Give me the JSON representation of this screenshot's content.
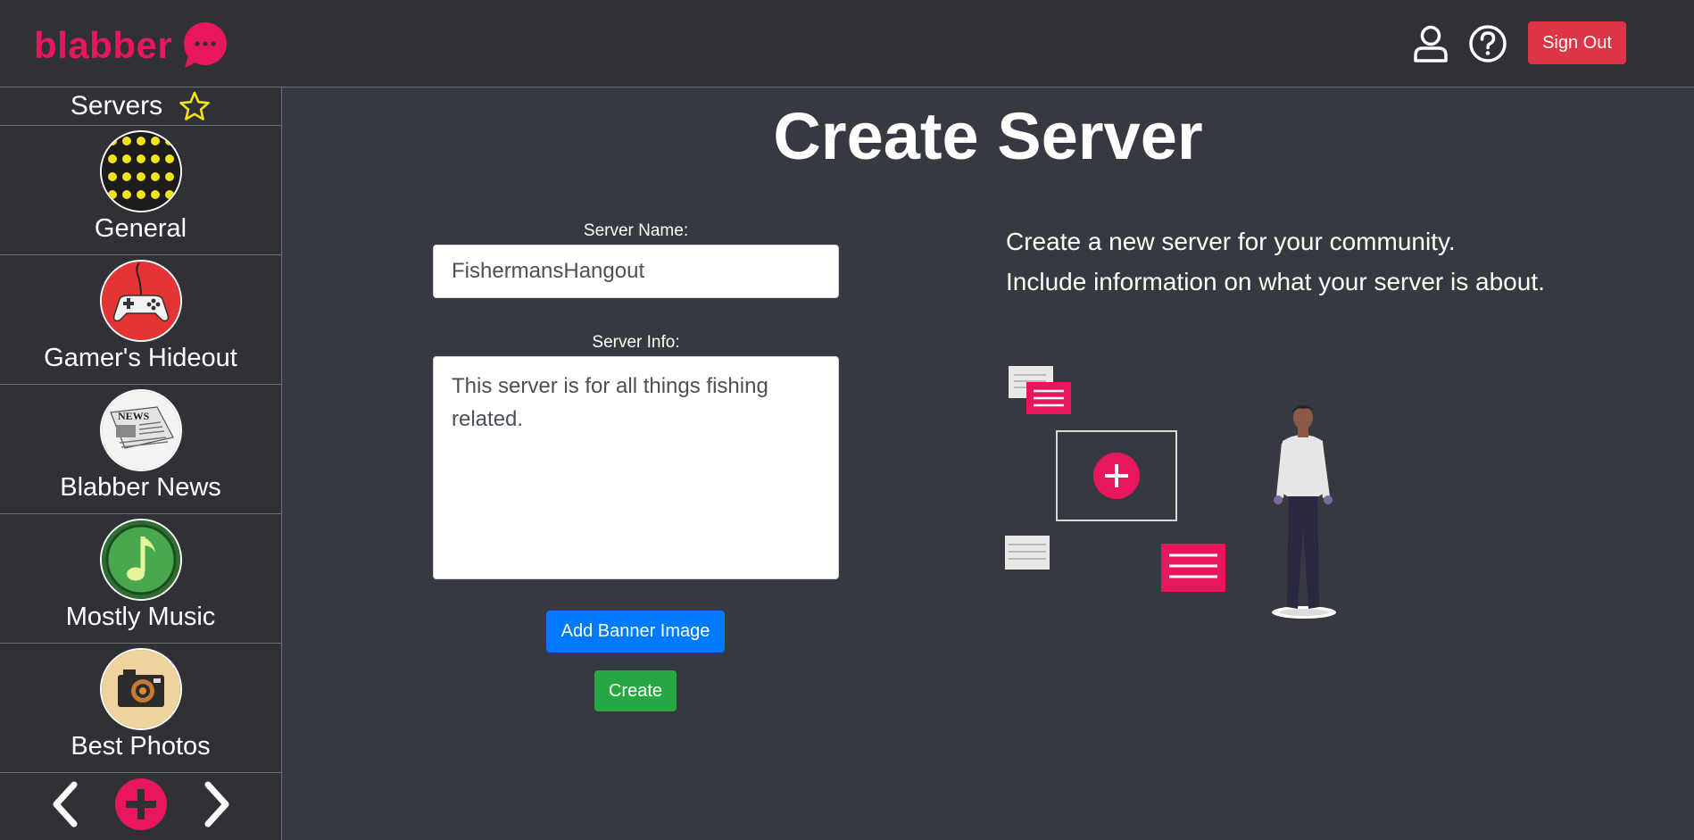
{
  "header": {
    "brand": "blabber",
    "signout_label": "Sign Out"
  },
  "sidebar": {
    "title": "Servers",
    "items": [
      {
        "label": "General"
      },
      {
        "label": "Gamer's Hideout"
      },
      {
        "label": "Blabber News"
      },
      {
        "label": "Mostly Music"
      },
      {
        "label": "Best Photos"
      }
    ],
    "news_text": "NEWS"
  },
  "main": {
    "title": "Create Server",
    "name_label": "Server Name:",
    "name_value": "FishermansHangout",
    "info_label": "Server Info:",
    "info_value": "This server is for all things fishing related.",
    "banner_button": "Add Banner Image",
    "create_button": "Create",
    "description_line1": "Create a new server for your community.",
    "description_line2": "Include information on what your server is about."
  },
  "colors": {
    "brand": "#e8175d",
    "signout": "#dc3545",
    "primary": "#007bff",
    "success": "#28a745"
  }
}
